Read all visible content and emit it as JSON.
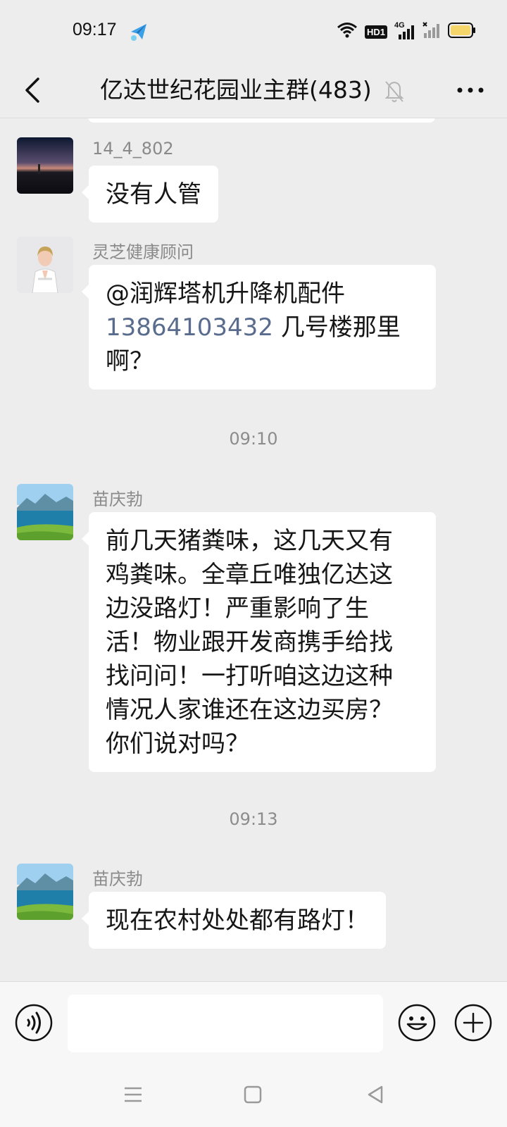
{
  "status_bar": {
    "time": "09:17",
    "icons": [
      "app-notification-icon",
      "wifi-icon",
      "hd-icon",
      "signal-4g-icon",
      "signal-icon",
      "battery-icon"
    ],
    "hd_label": "HD1",
    "network_label": "4G"
  },
  "header": {
    "title": "亿达世纪花园业主群(483)",
    "back_icon": "chevron-left-icon",
    "mute_icon": "bell-muted-icon",
    "more_icon": "more-dots-icon"
  },
  "messages": [
    {
      "sender": "14_4_802",
      "avatar": "sunset-water-avatar",
      "text": "没有人管"
    },
    {
      "sender": "灵芝健康顾问",
      "avatar": "woman-white-suit-avatar",
      "mention": "@润辉塔机升降机配件",
      "mention_number": "13864103432",
      "text_line2_suffix": " 几号楼那里",
      "text_line3": "啊？"
    },
    {
      "timestamp": "09:10"
    },
    {
      "sender": "苗庆勃",
      "avatar": "lake-mountain-avatar",
      "lines": [
        "前几天猪粪味，这几天又有",
        "鸡粪味。全章丘唯独亿达这",
        "边没路灯！严重影响了生",
        "活！物业跟开发商携手给找",
        "找问问！一打听咱这边这种",
        "情况人家谁还在这边买房？",
        "你们说对吗？"
      ]
    },
    {
      "timestamp": "09:13"
    },
    {
      "sender": "苗庆勃",
      "avatar": "lake-mountain-avatar",
      "text": "现在农村处处都有路灯！"
    }
  ],
  "input_bar": {
    "voice_icon": "voice-icon",
    "emoji_icon": "emoji-icon",
    "plus_icon": "plus-icon",
    "input_value": ""
  },
  "nav_bar": {
    "icons": [
      "menu-icon",
      "home-square-icon",
      "back-triangle-icon"
    ]
  },
  "colors": {
    "background": "#ededed",
    "bubble": "#ffffff",
    "mention_number": "#5a6c8e",
    "secondary_text": "#8a8a8a",
    "battery": "#f5d66b"
  }
}
